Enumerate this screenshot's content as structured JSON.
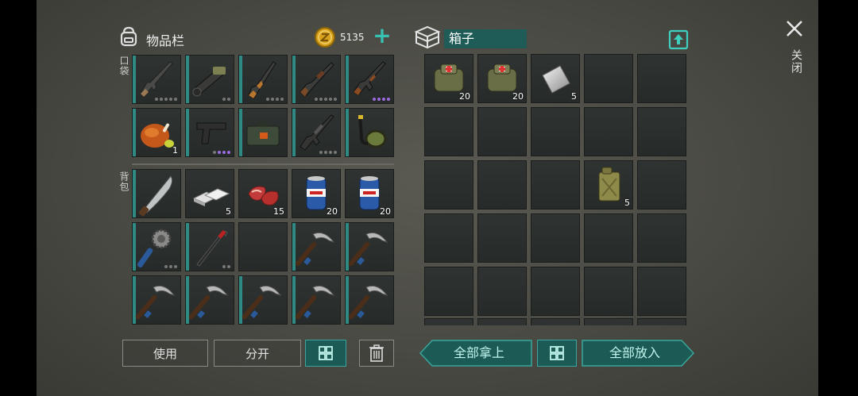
{
  "inventory": {
    "title": "物品栏",
    "coins": "5135",
    "plus_symbol": "+",
    "pocket_label": "口袋",
    "backpack_label": "背包",
    "pocket_slots": [
      {
        "icon": "rifle-icon",
        "count": ""
      },
      {
        "icon": "launcher-icon",
        "count": ""
      },
      {
        "icon": "shotgun-icon",
        "count": ""
      },
      {
        "icon": "pump-shotgun-icon",
        "count": ""
      },
      {
        "icon": "ak-rifle-icon",
        "count": ""
      },
      {
        "icon": "roast-chicken-icon",
        "count": "1"
      },
      {
        "icon": "pistol-icon",
        "count": ""
      },
      {
        "icon": "ammo-box-icon",
        "count": ""
      },
      {
        "icon": "assault-rifle-icon",
        "count": ""
      },
      {
        "icon": "snorkel-mask-icon",
        "count": ""
      }
    ],
    "backpack_slots": [
      {
        "icon": "machete-icon",
        "count": ""
      },
      {
        "icon": "metal-bars-icon",
        "count": "5"
      },
      {
        "icon": "raw-meat-icon",
        "count": "15"
      },
      {
        "icon": "beer-can-icon",
        "count": "20"
      },
      {
        "icon": "beer-can-icon",
        "count": "20"
      },
      {
        "icon": "spiked-mace-icon",
        "count": ""
      },
      {
        "icon": "crowbar-icon",
        "count": ""
      },
      {
        "icon": "empty-slot",
        "count": ""
      },
      {
        "icon": "pickaxe-icon",
        "count": ""
      },
      {
        "icon": "pickaxe-icon",
        "count": ""
      },
      {
        "icon": "pickaxe-icon",
        "count": ""
      },
      {
        "icon": "pickaxe-icon",
        "count": ""
      },
      {
        "icon": "pickaxe-icon",
        "count": ""
      },
      {
        "icon": "pickaxe-icon",
        "count": ""
      },
      {
        "icon": "pickaxe-icon",
        "count": ""
      }
    ]
  },
  "box": {
    "title": "箱子",
    "slots": [
      {
        "icon": "medkit-bag-icon",
        "count": "20"
      },
      {
        "icon": "medkit-bag-icon",
        "count": "20"
      },
      {
        "icon": "metal-sheet-icon",
        "count": "5"
      },
      {
        "icon": "jerrycan-icon",
        "count": "5"
      }
    ]
  },
  "buttons": {
    "use": "使用",
    "split": "分开",
    "take_all": "全部拿上",
    "put_all": "全部放入"
  },
  "close_label": "关闭",
  "colors": {
    "accent_teal": "#2e8a82",
    "coin_gold": "#d8a21c"
  }
}
